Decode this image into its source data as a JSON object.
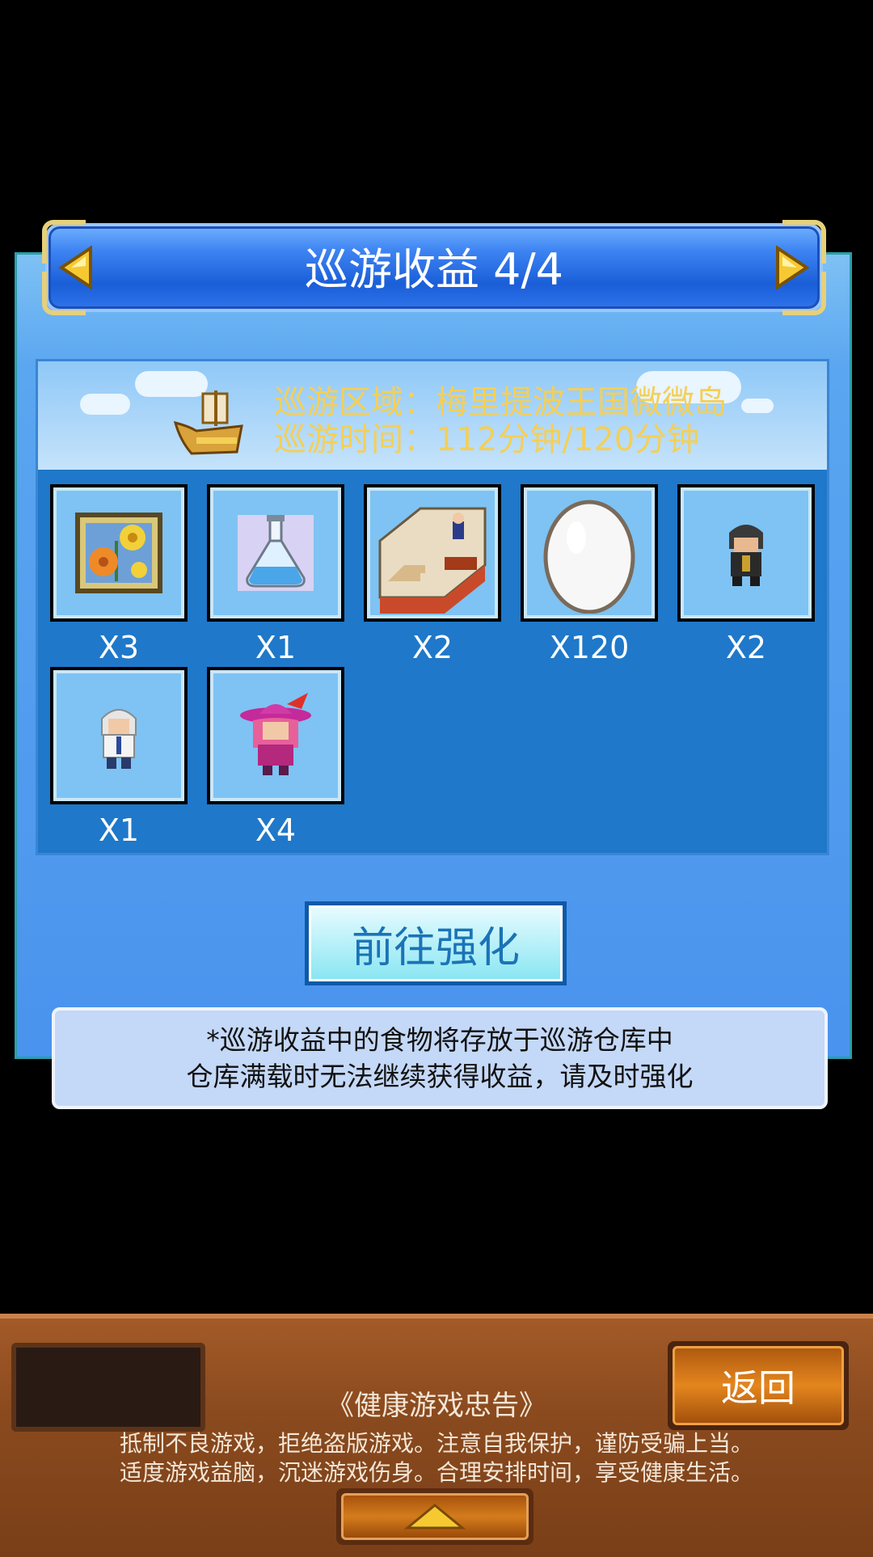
{
  "header": {
    "title": "巡游收益 4/4",
    "prev_icon": "triangle-left-icon",
    "next_icon": "triangle-right-icon"
  },
  "cruise": {
    "area": "巡游区域：梅里提波王国微微岛",
    "time": "巡游时间：112分钟/120分钟",
    "ship_icon": "golden-ship-icon"
  },
  "rewards": [
    {
      "icon": "flowers-painting-icon",
      "qty": "X3"
    },
    {
      "icon": "potion-flask-icon",
      "qty": "X1"
    },
    {
      "icon": "staircase-room-icon",
      "qty": "X2"
    },
    {
      "icon": "egg-icon",
      "qty": "X120"
    },
    {
      "icon": "dark-hooded-character-icon",
      "qty": "X2"
    },
    {
      "icon": "white-haired-character-icon",
      "qty": "X1"
    },
    {
      "icon": "pink-witch-character-icon",
      "qty": "X4"
    }
  ],
  "actions": {
    "enhance_label": "前往强化"
  },
  "note": {
    "line1": "*巡游收益中的食物将存放于巡游仓库中",
    "line2": "仓库满载时无法继续获得收益，请及时强化"
  },
  "footer": {
    "back_label": "返回",
    "notice_title": "《健康游戏忠告》",
    "notice_line1": "抵制不良游戏，拒绝盗版游戏。注意自我保护，谨防受骗上当。",
    "notice_line2": "适度游戏益脑，沉迷游戏伤身。合理安排时间，享受健康生活。",
    "up_icon": "triangle-up-icon"
  },
  "colors": {
    "panel_blue": "#4a93ee",
    "title_blue": "#1a5ed8",
    "info_gold": "#f4cf57",
    "wood": "#8a4a1e"
  }
}
